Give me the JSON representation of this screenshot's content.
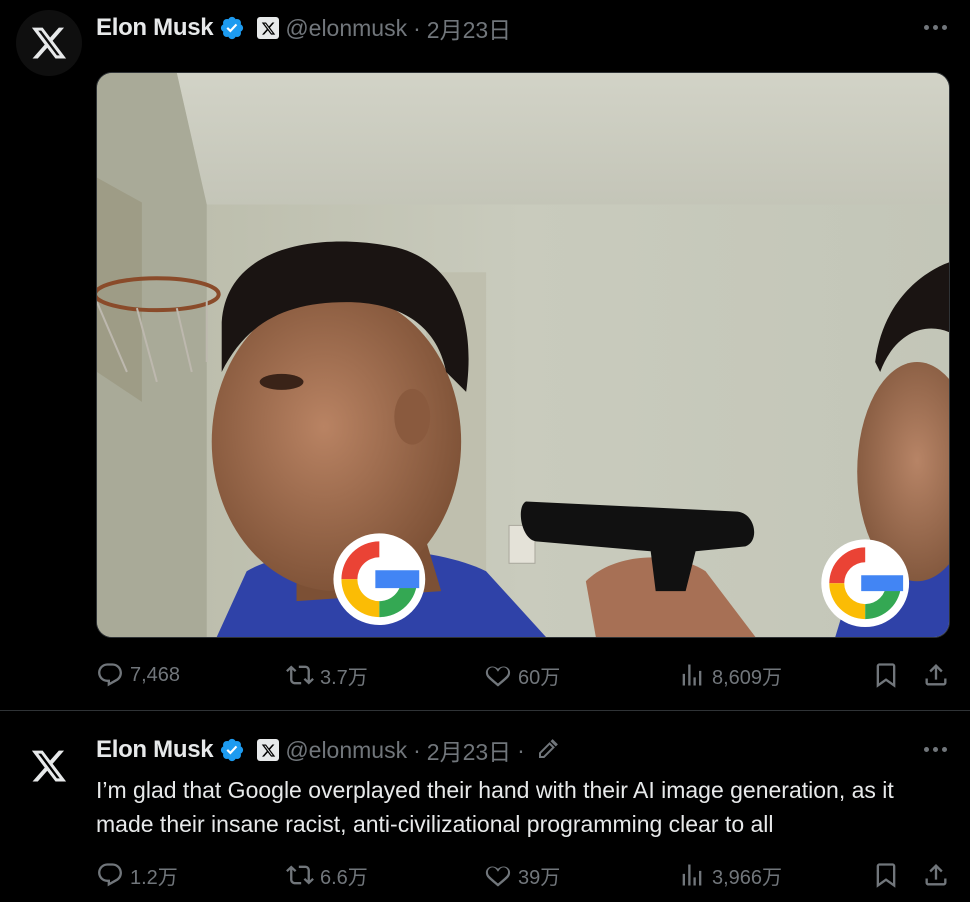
{
  "tweets": [
    {
      "author_name": "Elon Musk",
      "handle": "@elonmusk",
      "separator": "·",
      "date": "2月23日",
      "text": "",
      "media": {
        "overlay_text_left": "G",
        "overlay_text_right": "G"
      },
      "stats": {
        "replies": "7,468",
        "retweets": "3.7万",
        "likes": "60万",
        "views": "8,609万"
      }
    },
    {
      "author_name": "Elon Musk",
      "handle": "@elonmusk",
      "separator": "·",
      "date": "2月23日",
      "separator2": "·",
      "text": "I’m glad that Google overplayed their hand with their AI image generation, as it made their insane racist, anti-civilizational programming clear to all",
      "stats": {
        "replies": "1.2万",
        "retweets": "6.6万",
        "likes": "39万",
        "views": "3,966万"
      }
    }
  ],
  "colors": {
    "background": "#000000",
    "text_primary": "#e7e9ea",
    "text_secondary": "#71767b",
    "verified_blue": "#1d9bf0",
    "divider": "#2f3336"
  },
  "icons": [
    "x-logo-icon",
    "verified-icon",
    "x-badge-icon",
    "edit-icon",
    "more-icon",
    "reply-icon",
    "retweet-icon",
    "like-icon",
    "views-icon",
    "bookmark-icon",
    "share-icon"
  ]
}
